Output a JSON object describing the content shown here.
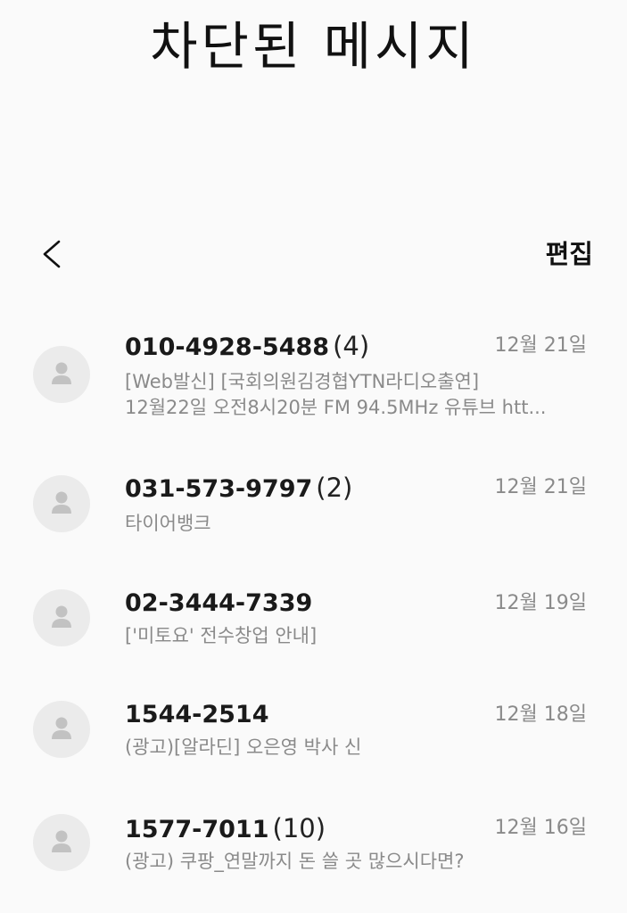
{
  "header": {
    "title": "차단된 메시지",
    "edit_label": "편집"
  },
  "icons": {
    "back": "chevron-left-icon",
    "avatar": "person-icon"
  },
  "messages": [
    {
      "sender": "010-4928-5488",
      "count": "(4)",
      "date": "12월 21일",
      "preview_line1": "[Web발신] [국회의원김경협YTN라디오출연]",
      "preview_line2": "12월22일 오전8시20분 FM 94.5MHz 유튜브 htt..."
    },
    {
      "sender": "031-573-9797",
      "count": "(2)",
      "date": "12월 21일",
      "preview_line1": "타이어뱅크"
    },
    {
      "sender": "02-3444-7339",
      "date": "12월 19일",
      "preview_line1": "['미토요' 전수창업 안내]"
    },
    {
      "sender": "1544-2514",
      "date": "12월 18일",
      "preview_line1": "(광고)[알라딘] 오은영 박사 신"
    },
    {
      "sender": "1577-7011",
      "count": "(10)",
      "date": "12월 16일",
      "preview_line1": "(광고) 쿠팡_연말까지 돈 쓸 곳 많으시다면?"
    }
  ],
  "colors": {
    "background": "#fafafa",
    "avatar_bg": "#ebebeb",
    "avatar_fg": "#c2c2c2",
    "secondary_text": "#8a8a8a"
  }
}
